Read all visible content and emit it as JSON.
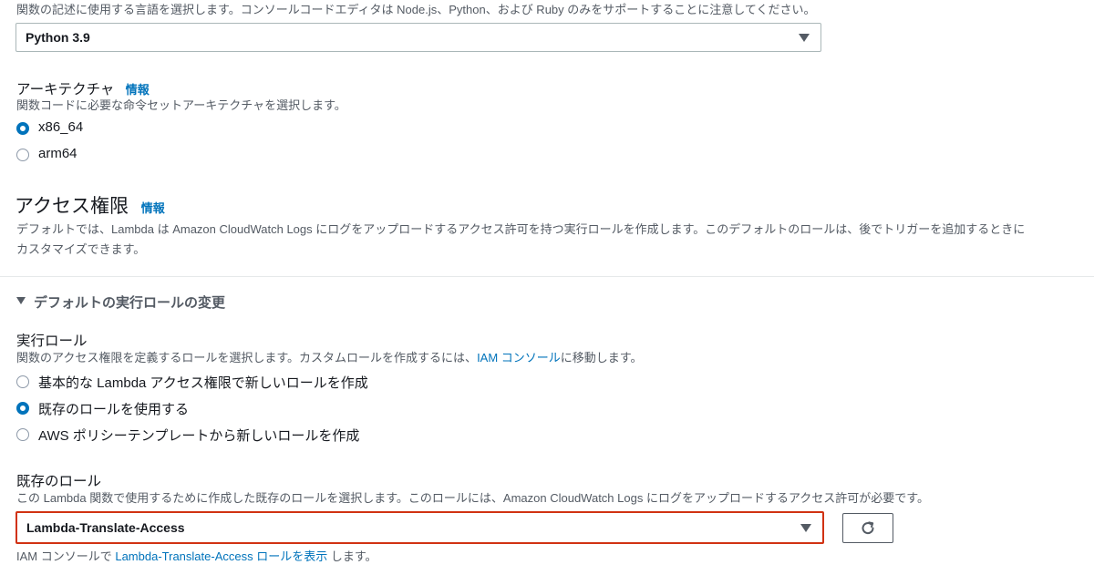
{
  "runtime": {
    "description": "関数の記述に使用する言語を選択します。コンソールコードエディタは Node.js、Python、および Ruby のみをサポートすることに注意してください。",
    "selected": "Python 3.9"
  },
  "architecture": {
    "title": "アーキテクチャ",
    "info": "情報",
    "description": "関数コードに必要な命令セットアーキテクチャを選択します。",
    "options": [
      "x86_64",
      "arm64"
    ],
    "selected_index": 0
  },
  "permissions": {
    "title": "アクセス権限",
    "info": "情報",
    "description_line1": "デフォルトでは、Lambda は Amazon CloudWatch Logs にログをアップロードするアクセス許可を持つ実行ロールを作成します。このデフォルトのロールは、後でトリガーを追加するときに",
    "description_line2": "カスタマイズできます。"
  },
  "execution_role": {
    "expander": "デフォルトの実行ロールの変更",
    "title": "実行ロール",
    "description_prefix": "関数のアクセス権限を定義するロールを選択します。カスタムロールを作成するには、",
    "description_link": "IAM コンソール",
    "description_suffix": "に移動します。",
    "options": [
      "基本的な Lambda アクセス権限で新しいロールを作成",
      "既存のロールを使用する",
      "AWS ポリシーテンプレートから新しいロールを作成"
    ],
    "selected_index": 1
  },
  "existing_role": {
    "title": "既存のロール",
    "description": "この Lambda 関数で使用するために作成した既存のロールを選択します。このロールには、Amazon CloudWatch Logs にログをアップロードするアクセス許可が必要です。",
    "selected": "Lambda-Translate-Access",
    "footer_prefix": "IAM コンソールで ",
    "footer_link": "Lambda-Translate-Access ロールを表示",
    "footer_suffix": " します。"
  },
  "colors": {
    "accent": "#0073bb",
    "highlight_border": "#d13212",
    "text": "#16191f",
    "muted": "#545b64"
  },
  "icons": {
    "refresh": "refresh-icon",
    "caret": "caret-down-icon",
    "expander": "triangle-down-icon"
  }
}
